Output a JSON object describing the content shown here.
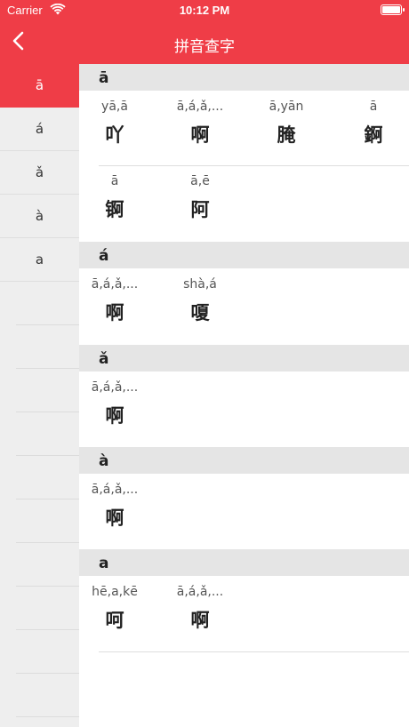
{
  "status_bar": {
    "carrier": "Carrier",
    "time": "10:12 PM"
  },
  "nav": {
    "title": "拼音查字"
  },
  "left_index": [
    "ā",
    "á",
    "ǎ",
    "à",
    "a"
  ],
  "sections": [
    {
      "header": "ā",
      "rows": [
        [
          {
            "pinyin": "yā,ā",
            "char": "吖"
          },
          {
            "pinyin": "ā,á,ǎ,...",
            "char": "啊"
          },
          {
            "pinyin": "ā,yān",
            "char": "腌"
          },
          {
            "pinyin": "ā",
            "char": "錒"
          }
        ],
        [
          {
            "pinyin": "ā",
            "char": "锕"
          },
          {
            "pinyin": "ā,ē",
            "char": "阿"
          }
        ]
      ]
    },
    {
      "header": "á",
      "rows": [
        [
          {
            "pinyin": "ā,á,ǎ,...",
            "char": "啊"
          },
          {
            "pinyin": "shà,á",
            "char": "嗄"
          }
        ]
      ]
    },
    {
      "header": "ǎ",
      "rows": [
        [
          {
            "pinyin": "ā,á,ǎ,...",
            "char": "啊"
          }
        ]
      ]
    },
    {
      "header": "à",
      "rows": [
        [
          {
            "pinyin": "ā,á,ǎ,...",
            "char": "啊"
          }
        ]
      ]
    },
    {
      "header": "a",
      "rows": [
        [
          {
            "pinyin": "hē,a,kē",
            "char": "呵"
          },
          {
            "pinyin": "ā,á,ǎ,...",
            "char": "啊"
          }
        ]
      ]
    }
  ]
}
